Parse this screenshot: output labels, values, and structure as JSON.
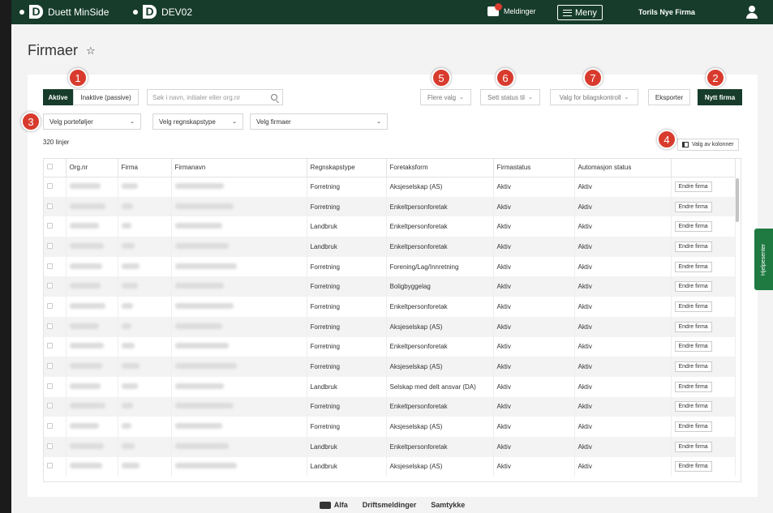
{
  "topbar": {
    "brand": "Duett MinSide",
    "env": "DEV02",
    "messages_label": "Meldinger",
    "menu_label": "Meny",
    "firm_name": "Torils Nye Firma"
  },
  "page": {
    "title": "Firmaer"
  },
  "toolbar": {
    "active_label": "Aktive",
    "inactive_label": "Inaktive (passive)",
    "search_placeholder": "Søk i navn, initialer eller org.nr",
    "more_options": "Flere valg",
    "set_status": "Sett status til",
    "voucher_control": "Valg for bilagskontroll",
    "export": "Eksporter",
    "new_firm": "Nytt firma"
  },
  "filters": {
    "portfolios": "Velg porteføljer",
    "accounting_type": "Velg regnskapstype",
    "firms": "Velg firmaer"
  },
  "list": {
    "count": "320 linjer",
    "columns_button": "Valg av kolonner"
  },
  "badges": [
    "1",
    "2",
    "3",
    "4",
    "5",
    "6",
    "7"
  ],
  "table": {
    "headers": [
      "Org.nr",
      "Firma",
      "Firmanavn",
      "Regnskapstype",
      "Foretaksform",
      "Firmastatus",
      "Automasjon status"
    ],
    "edit_label": "Endre firma",
    "rows": [
      {
        "regnskapstype": "Forretning",
        "foretaksform": "Aksjeselskap (AS)",
        "status": "Aktiv",
        "automasjon": "Aktiv"
      },
      {
        "regnskapstype": "Forretning",
        "foretaksform": "Enkeltpersonforetak",
        "status": "Aktiv",
        "automasjon": "Aktiv"
      },
      {
        "regnskapstype": "Landbruk",
        "foretaksform": "Enkeltpersonforetak",
        "status": "Aktiv",
        "automasjon": "Aktiv"
      },
      {
        "regnskapstype": "Landbruk",
        "foretaksform": "Enkeltpersonforetak",
        "status": "Aktiv",
        "automasjon": "Aktiv"
      },
      {
        "regnskapstype": "Forretning",
        "foretaksform": "Forening/Lag/Innretning",
        "status": "Aktiv",
        "automasjon": "Aktiv"
      },
      {
        "regnskapstype": "Forretning",
        "foretaksform": "Boligbyggelag",
        "status": "Aktiv",
        "automasjon": "Aktiv"
      },
      {
        "regnskapstype": "Forretning",
        "foretaksform": "Enkeltpersonforetak",
        "status": "Aktiv",
        "automasjon": "Aktiv"
      },
      {
        "regnskapstype": "Forretning",
        "foretaksform": "Aksjeselskap (AS)",
        "status": "Aktiv",
        "automasjon": "Aktiv"
      },
      {
        "regnskapstype": "Forretning",
        "foretaksform": "Enkeltpersonforetak",
        "status": "Aktiv",
        "automasjon": "Aktiv"
      },
      {
        "regnskapstype": "Forretning",
        "foretaksform": "Aksjeselskap (AS)",
        "status": "Aktiv",
        "automasjon": "Aktiv"
      },
      {
        "regnskapstype": "Landbruk",
        "foretaksform": "Selskap med delt ansvar (DA)",
        "status": "Aktiv",
        "automasjon": "Aktiv"
      },
      {
        "regnskapstype": "Forretning",
        "foretaksform": "Enkeltpersonforetak",
        "status": "Aktiv",
        "automasjon": "Aktiv"
      },
      {
        "regnskapstype": "Forretning",
        "foretaksform": "Aksjeselskap (AS)",
        "status": "Aktiv",
        "automasjon": "Aktiv"
      },
      {
        "regnskapstype": "Landbruk",
        "foretaksform": "Enkeltpersonforetak",
        "status": "Aktiv",
        "automasjon": "Aktiv"
      },
      {
        "regnskapstype": "Landbruk",
        "foretaksform": "Aksjeselskap (AS)",
        "status": "Aktiv",
        "automasjon": "Aktiv"
      }
    ]
  },
  "help_panel": "Hjelpesenter",
  "footer": {
    "alfa": "Alfa",
    "operations": "Driftsmeldinger",
    "consent": "Samtykke"
  },
  "colors": {
    "header": "#173c2c",
    "badge": "#d83b2d",
    "help": "#1f7a42"
  }
}
